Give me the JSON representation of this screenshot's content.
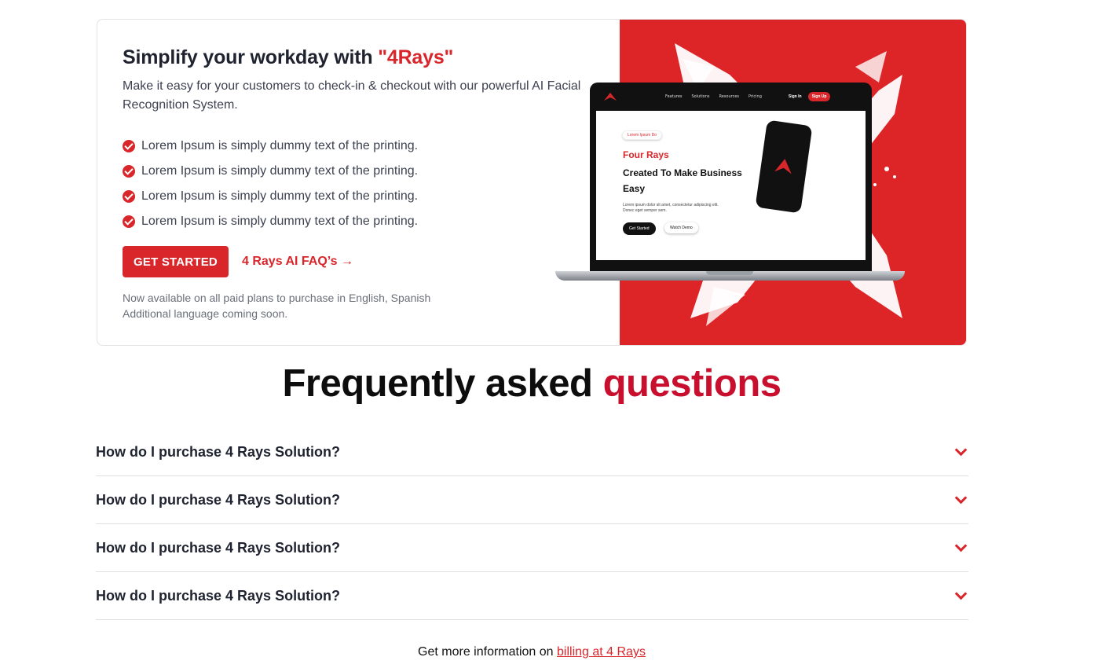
{
  "hero": {
    "title_prefix": "Simplify your workday with ",
    "title_accent": "\"4Rays\"",
    "subtitle": "Make it easy for your customers to check-in & checkout with our powerful AI Facial Recognition System.",
    "features": [
      "Lorem Ipsum is simply dummy text of the printing.",
      "Lorem Ipsum is simply dummy text of the printing.",
      "Lorem Ipsum is simply dummy text of the printing.",
      "Lorem Ipsum is simply dummy text of the printing."
    ],
    "get_started_label": "GET STARTED",
    "faq_link_label": "4 Rays AI FAQ’s →",
    "availability_line1": "Now available on all paid plans to purchase in English, Spanish",
    "availability_line2": "Additional language coming soon."
  },
  "laptop_mock": {
    "nav_links": [
      "Features",
      "Solutions",
      "Resources",
      "Pricing"
    ],
    "sign_in": "Sign In",
    "sign_up": "Sign Up",
    "pill": "Lorem Ipsum Do",
    "title_red": "Four Rays",
    "title_dark": "Created To Make Business Easy",
    "body": "Lorem ipsum dolor sit amet, consectetur adipiscing elit. Donec eget semper sem.",
    "btn_primary": "Get Started",
    "btn_secondary": "Watch Demo"
  },
  "faq": {
    "heading_prefix": "Frequently asked ",
    "heading_accent": "questions",
    "items": [
      {
        "question": "How do I purchase 4 Rays Solution?"
      },
      {
        "question": "How do I purchase 4 Rays Solution?"
      },
      {
        "question": "How do I purchase 4 Rays Solution?"
      },
      {
        "question": "How do I purchase 4 Rays Solution?"
      }
    ]
  },
  "footer": {
    "info_text": "Get more information on ",
    "link_text": "billing at 4 Rays"
  },
  "colors": {
    "accent": "#d8262b",
    "heading_accent": "#c8102e"
  }
}
